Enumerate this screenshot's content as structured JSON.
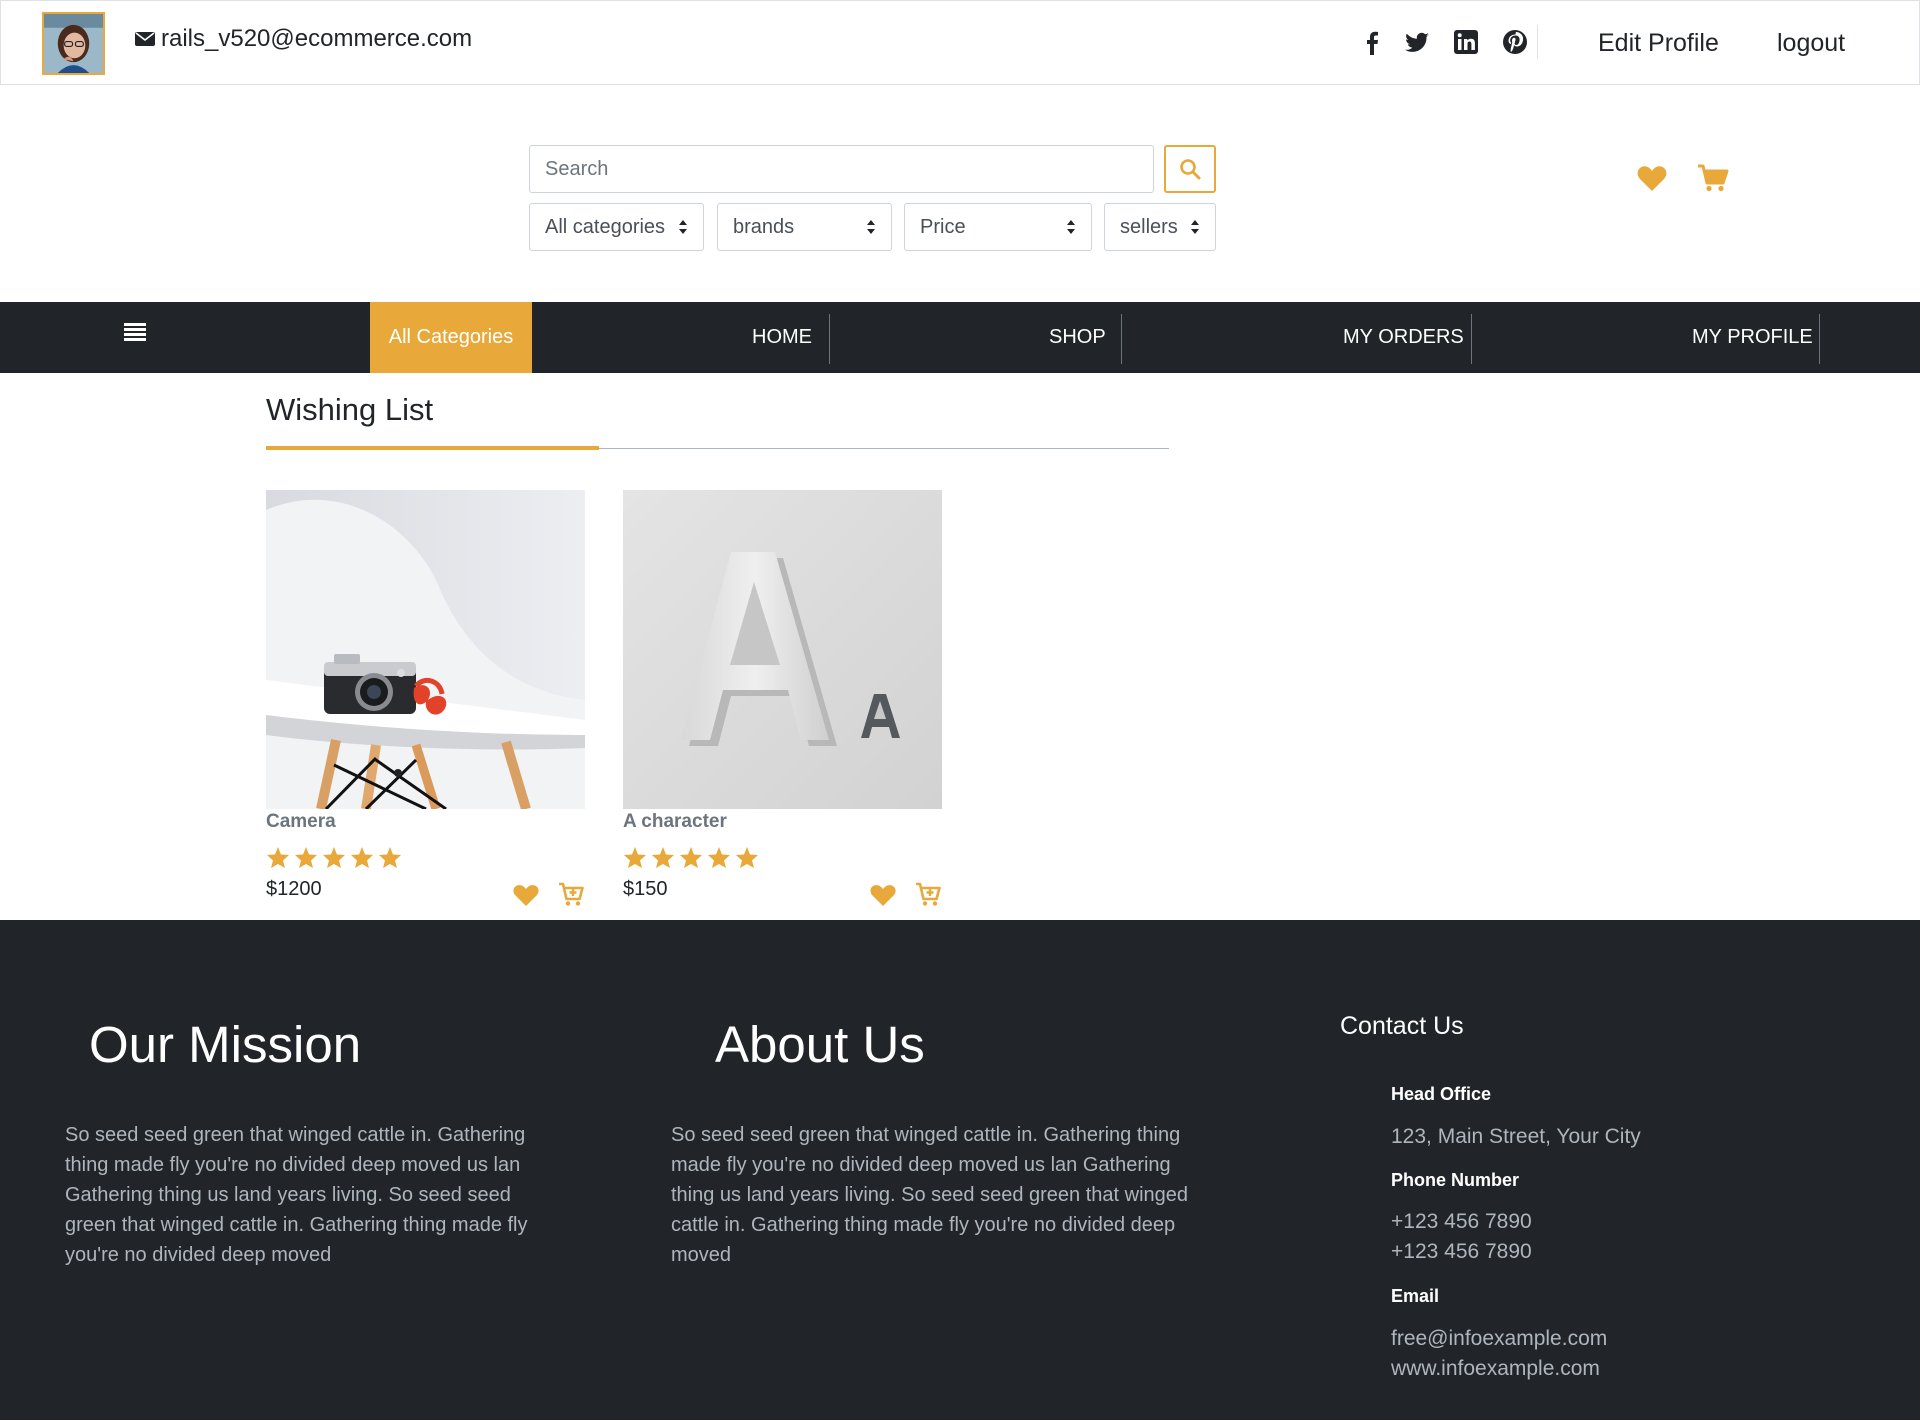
{
  "topbar": {
    "email": "rails_v520@ecommerce.com",
    "edit_profile": "Edit Profile",
    "logout": "logout",
    "social": [
      "facebook-icon",
      "twitter-icon",
      "linkedin-icon",
      "pinterest-icon"
    ]
  },
  "search": {
    "placeholder": "Search",
    "filters": [
      "All categories",
      "brands",
      "Price",
      "sellers"
    ]
  },
  "nav": {
    "all_categories": "All Categories",
    "links": [
      "HOME",
      "SHOP",
      "MY ORDERS",
      "MY PROFILE"
    ]
  },
  "wishlist": {
    "title": "Wishing List",
    "products": [
      {
        "name": "Camera",
        "price": "$1200",
        "rating": 5,
        "image": "camera-on-chair"
      },
      {
        "name": "A character",
        "price": "$150",
        "rating": 5,
        "image": "letter-a-sculpture"
      }
    ]
  },
  "footer": {
    "mission_title": "Our Mission",
    "mission_text": "So seed seed green that winged cattle in. Gathering thing made fly you're no divided deep moved us lan Gathering thing us land years living. So seed seed green that winged cattle in. Gathering thing made fly you're no divided deep moved",
    "about_title": "About Us",
    "about_text": "So seed seed green that winged cattle in. Gathering thing made fly you're no divided deep moved us lan Gathering thing us land years living. So seed seed green that winged cattle in. Gathering thing made fly you're no divided deep moved",
    "contact_title": "Contact Us",
    "head_office_label": "Head Office",
    "head_office": "123, Main Street, Your City",
    "phone_label": "Phone Number",
    "phone_1": "+123 456 7890",
    "phone_2": "+123 456 7890",
    "email_label": "Email",
    "email_1": "free@infoexample.com",
    "email_2": "www.infoexample.com"
  },
  "colors": {
    "accent": "#e8a93a",
    "dark": "#212529",
    "muted_text": "#adb5bd"
  }
}
